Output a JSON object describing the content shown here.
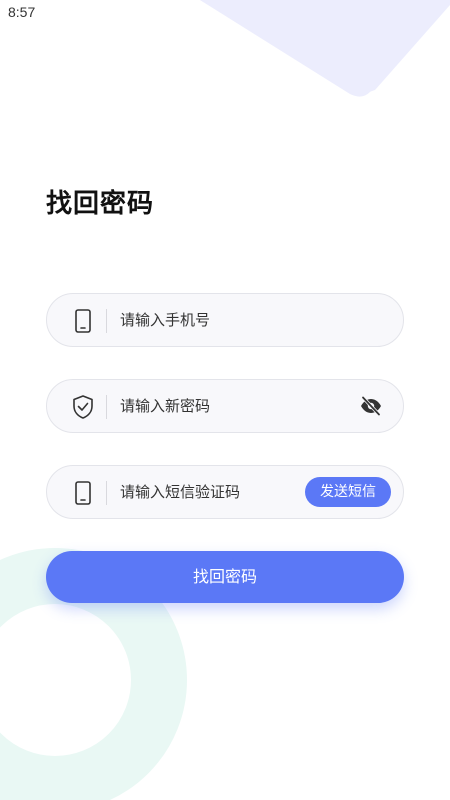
{
  "status_bar": {
    "time": "8:57"
  },
  "page": {
    "title": "找回密码"
  },
  "form": {
    "phone": {
      "placeholder": "请输入手机号",
      "value": "",
      "icon": "phone-icon"
    },
    "new_password": {
      "placeholder": "请输入新密码",
      "value": "",
      "icon": "shield-check-icon",
      "toggle_icon": "eye-off-icon"
    },
    "sms_code": {
      "placeholder": "请输入短信验证码",
      "value": "",
      "icon": "phone-icon",
      "send_label": "发送短信"
    },
    "submit_label": "找回密码"
  },
  "colors": {
    "accent": "#5b78f6",
    "field_bg": "#f8f8fb",
    "deco_top": "#ecedfd",
    "deco_bottom": "#e9f8f4"
  }
}
